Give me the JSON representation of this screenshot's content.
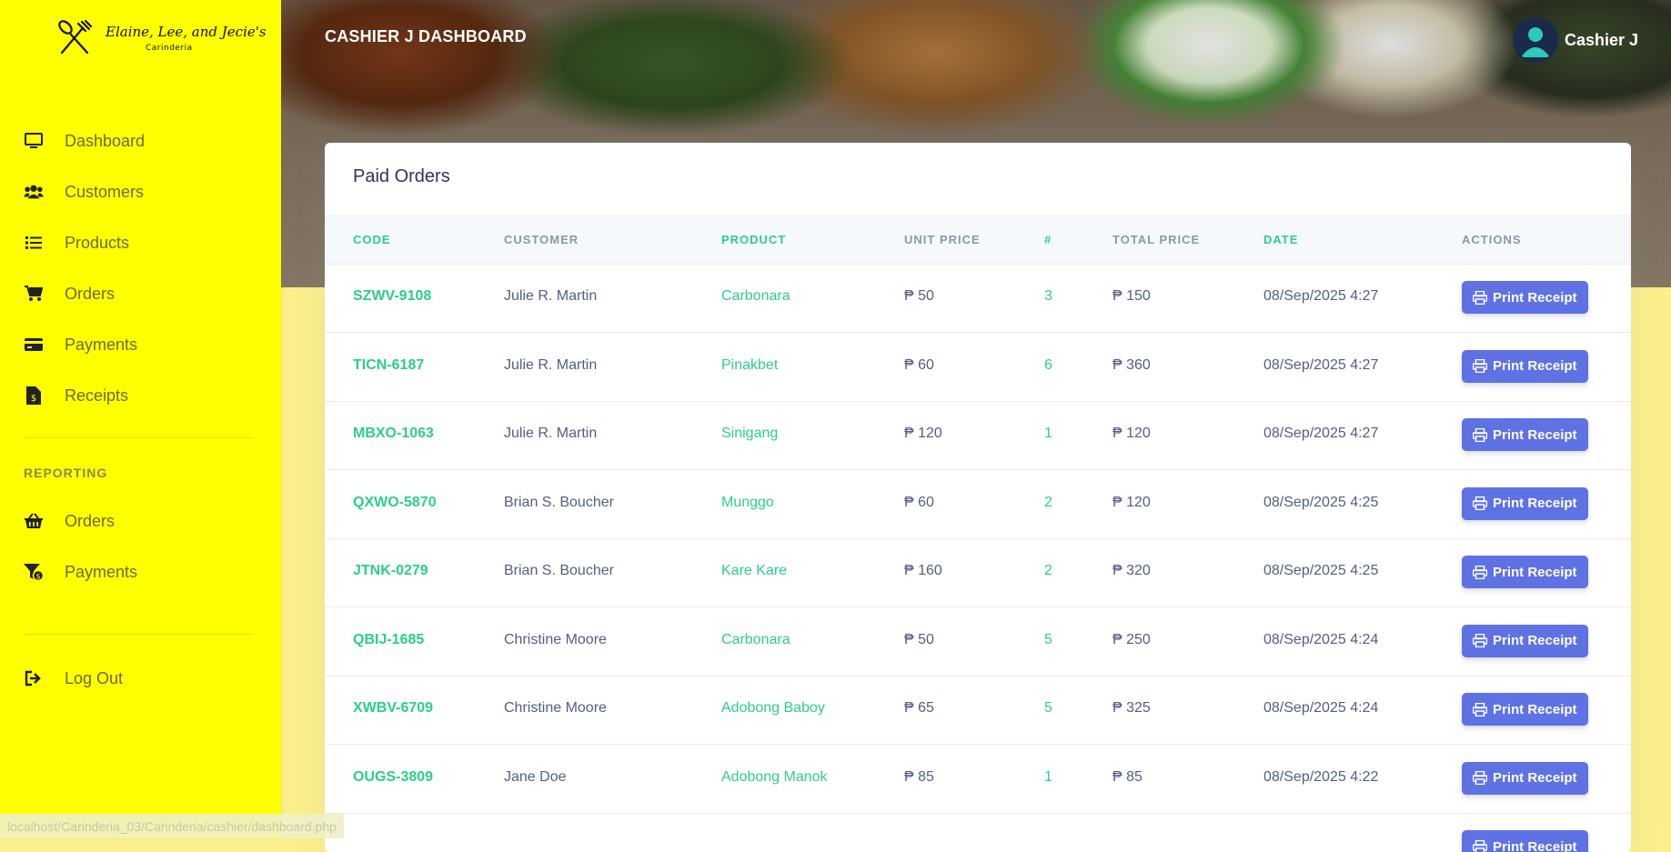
{
  "brand": {
    "line1": "Elaine, Lee, and Jecie's",
    "line2": "Carinderia"
  },
  "sidebar": {
    "items": [
      {
        "label": "Dashboard",
        "icon": "monitor-icon"
      },
      {
        "label": "Customers",
        "icon": "users-icon"
      },
      {
        "label": "Products",
        "icon": "list-icon"
      },
      {
        "label": "Orders",
        "icon": "cart-icon"
      },
      {
        "label": "Payments",
        "icon": "credit-card-icon"
      },
      {
        "label": "Receipts",
        "icon": "file-invoice-icon"
      }
    ],
    "reporting_heading": "REPORTING",
    "reporting_items": [
      {
        "label": "Orders",
        "icon": "basket-icon"
      },
      {
        "label": "Payments",
        "icon": "funnel-dollar-icon"
      }
    ],
    "logout_label": "Log Out"
  },
  "header": {
    "title": "CASHIER J DASHBOARD",
    "username": "Cashier J"
  },
  "card": {
    "title": "Paid Orders",
    "columns": [
      "CODE",
      "CUSTOMER",
      "PRODUCT",
      "UNIT PRICE",
      "#",
      "TOTAL PRICE",
      "DATE",
      "ACTIONS"
    ],
    "action_label": "Print Receipt",
    "rows": [
      {
        "code": "SZWV-9108",
        "customer": "Julie R. Martin",
        "product": "Carbonara",
        "unit": "₱ 50",
        "qty": "3",
        "total": "₱ 150",
        "date": "08/Sep/2025 4:27"
      },
      {
        "code": "TICN-6187",
        "customer": "Julie R. Martin",
        "product": "Pinakbet",
        "unit": "₱ 60",
        "qty": "6",
        "total": "₱ 360",
        "date": "08/Sep/2025 4:27"
      },
      {
        "code": "MBXO-1063",
        "customer": "Julie R. Martin",
        "product": "Sinigang",
        "unit": "₱ 120",
        "qty": "1",
        "total": "₱ 120",
        "date": "08/Sep/2025 4:27"
      },
      {
        "code": "QXWO-5870",
        "customer": "Brian S. Boucher",
        "product": "Munggo",
        "unit": "₱ 60",
        "qty": "2",
        "total": "₱ 120",
        "date": "08/Sep/2025 4:25"
      },
      {
        "code": "JTNK-0279",
        "customer": "Brian S. Boucher",
        "product": "Kare Kare",
        "unit": "₱ 160",
        "qty": "2",
        "total": "₱ 320",
        "date": "08/Sep/2025 4:25"
      },
      {
        "code": "QBIJ-1685",
        "customer": "Christine Moore",
        "product": "Carbonara",
        "unit": "₱ 50",
        "qty": "5",
        "total": "₱ 250",
        "date": "08/Sep/2025 4:24"
      },
      {
        "code": "XWBV-6709",
        "customer": "Christine Moore",
        "product": "Adobong Baboy",
        "unit": "₱ 65",
        "qty": "5",
        "total": "₱ 325",
        "date": "08/Sep/2025 4:24"
      },
      {
        "code": "OUGS-3809",
        "customer": "Jane Doe",
        "product": "Adobong Manok",
        "unit": "₱ 85",
        "qty": "1",
        "total": "₱ 85",
        "date": "08/Sep/2025 4:22"
      },
      {
        "code": "",
        "customer": "",
        "product": "",
        "unit": "",
        "qty": "",
        "total": "",
        "date": ""
      }
    ]
  },
  "statusbar": {
    "url": "localhost/Carinderia_03/Carinderia/cashier/dashboard.php"
  },
  "colors": {
    "sidebar": "#ffff00",
    "accent_green": "#2dce89",
    "button": "#5e72e4"
  }
}
